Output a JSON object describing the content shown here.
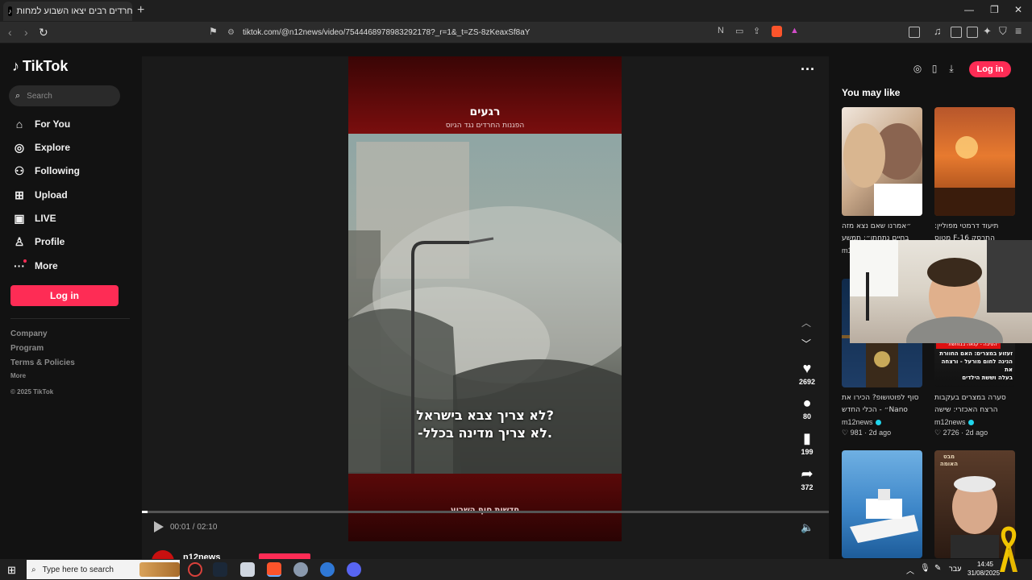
{
  "browser": {
    "tab_title": "חרדים רבים יצאו השבוע למחות...",
    "new_tab": "+",
    "url": "tiktok.com/@n12news/video/7544468978983292178?_r=1&_t=ZS-8zKeaxSf8aY",
    "window_minimize": "—",
    "window_maximize": "❐",
    "window_close": "✕"
  },
  "sidebar": {
    "logo": "TikTok",
    "search_placeholder": "Search",
    "nav": [
      {
        "label": "For You",
        "icon": "home-icon"
      },
      {
        "label": "Explore",
        "icon": "compass-icon"
      },
      {
        "label": "Following",
        "icon": "following-icon"
      },
      {
        "label": "Upload",
        "icon": "upload-icon"
      },
      {
        "label": "LIVE",
        "icon": "live-icon"
      },
      {
        "label": "Profile",
        "icon": "profile-icon"
      },
      {
        "label": "More",
        "icon": "more-icon"
      }
    ],
    "login": "Log in",
    "footer": {
      "company": "Company",
      "program": "Program",
      "terms": "Terms & Policies",
      "more": "More",
      "copyright": "© 2025 TikTok"
    }
  },
  "video": {
    "channel_logo_top": "רגעים",
    "channel_sub_top": "הפגנות החרדים נגד הגיוס",
    "subtitle_line1": "לא צריך צבא בישראל?",
    "subtitle_line2": "-לא צריך מדינה בכלל.",
    "channel_logo_bottom": "חדשות סוף השבוע",
    "time": "00:01 / 02:10",
    "progress": 0.008,
    "author": "n12news",
    "actions": {
      "likes": "2692",
      "comments": "80",
      "saves": "199",
      "shares": "372"
    }
  },
  "right_panel": {
    "login": "Log in",
    "heading": "You may like",
    "cards": [
      {
        "title_l1": "״אמרנו שאם נצא מזה",
        "title_l2": "בחיים נתחתן״: תמשע",
        "author": "m1",
        "likes": "",
        "age": ""
      },
      {
        "title_l1": "תיעוד דרמטי מפוליין:",
        "title_l2": "התרסק F-16 מטוס",
        "author": "",
        "likes": "",
        "age": ""
      },
      {
        "title_l1": "סוף לפוטושופ? הכירו את",
        "title_l2": "Nano״ - הכלי החדש",
        "author": "m12news",
        "likes": "981",
        "age": "2d ago"
      },
      {
        "title_l1": "סערה במצרים בעקבות",
        "title_l2": "הרצח האכזרי: שישה",
        "author": "m12news",
        "likes": "2726",
        "age": "2d ago"
      },
      {
        "title_l1": "",
        "title_l2": "",
        "author": "",
        "likes": "",
        "age": ""
      },
      {
        "title_l1": "",
        "title_l2": "",
        "author": "",
        "likes": "",
        "age": ""
      }
    ],
    "overlay_text_1": "זעזוע במצרים: האם החוורת",
    "overlay_text_2": "הנינה לחום מורעל - ורצחה את",
    "overlay_text_3": "בעלה וששת הילדים",
    "overlay_badge": "\"הסיבה - קנאה בבוחשת\"",
    "thumb6_label": "מבט האומה"
  },
  "taskbar": {
    "search_placeholder": "Type here to search",
    "lang": "עבר",
    "time": "14:45",
    "date": "31/08/2025"
  }
}
